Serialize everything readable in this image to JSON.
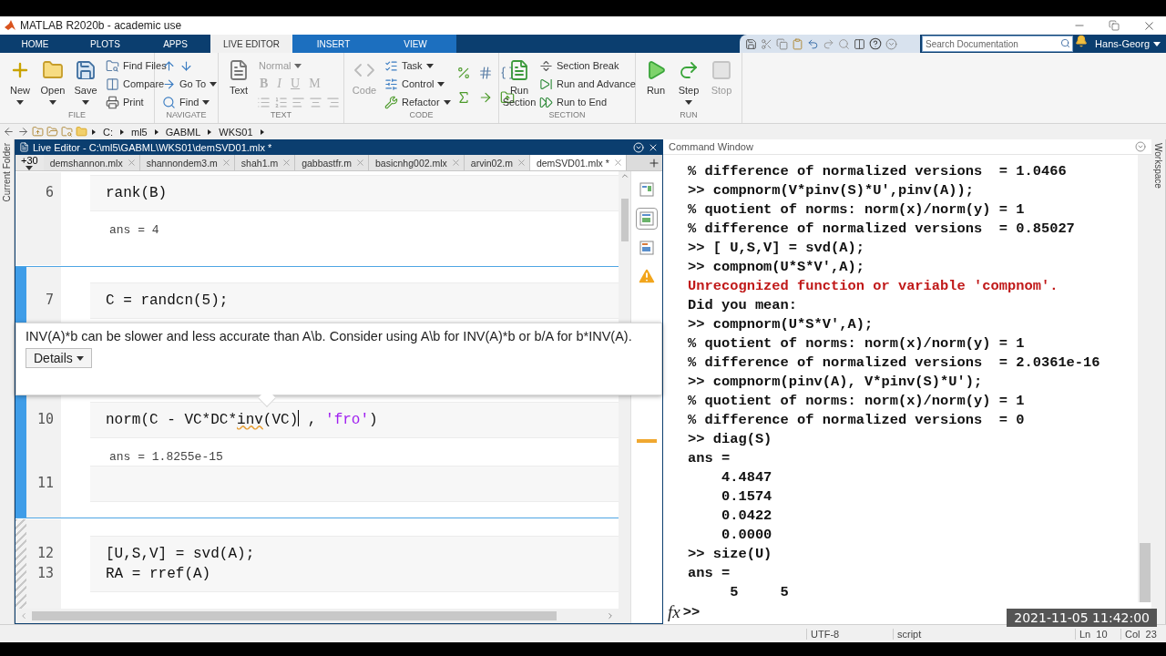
{
  "title_bar": {
    "title": "MATLAB R2020b - academic use"
  },
  "ribbon_tabs": [
    {
      "label": "HOME",
      "kind": "main",
      "selected": false
    },
    {
      "label": "PLOTS",
      "kind": "main",
      "selected": false
    },
    {
      "label": "APPS",
      "kind": "main",
      "selected": false
    },
    {
      "label": "LIVE EDITOR",
      "kind": "contextual",
      "selected": true
    },
    {
      "label": "INSERT",
      "kind": "contextual",
      "selected": false
    },
    {
      "label": "VIEW",
      "kind": "contextual",
      "selected": false
    }
  ],
  "search": {
    "placeholder": "Search Documentation"
  },
  "user": {
    "name": "Hans-Georg"
  },
  "toolstrip": [
    {
      "title": "FILE",
      "groups": [
        {
          "kind": "large",
          "label": "New",
          "caret": true,
          "disabled": false
        },
        {
          "kind": "large",
          "label": "Open",
          "caret": true,
          "disabled": false
        },
        {
          "kind": "large",
          "label": "Save",
          "caret": true,
          "disabled": false
        },
        {
          "kind": "column",
          "items": [
            {
              "kind": "button",
              "label": "Find Files",
              "caret": false,
              "disabled": false
            },
            {
              "kind": "button",
              "label": "Compare",
              "caret": false,
              "disabled": false
            },
            {
              "kind": "button",
              "label": "Print",
              "caret": false,
              "disabled": false
            }
          ]
        }
      ]
    },
    {
      "title": "NAVIGATE",
      "groups": [
        {
          "kind": "column",
          "items": [
            {
              "kind": "arrows"
            },
            {
              "kind": "button",
              "label": "Go To",
              "caret": true,
              "disabled": false
            },
            {
              "kind": "button",
              "label": "Find",
              "caret": true,
              "disabled": false
            }
          ]
        }
      ]
    },
    {
      "title": "TEXT",
      "groups": [
        {
          "kind": "large",
          "label": "Text",
          "caret": false,
          "disabled": false
        },
        {
          "kind": "format",
          "style": {
            "label": "Normal",
            "caret": true,
            "disabled": true
          },
          "marks": [
            {
              "label": "B",
              "disabled": true
            },
            {
              "label": "I",
              "disabled": true
            },
            {
              "label": "U",
              "disabled": true
            },
            {
              "label": "M",
              "disabled": true
            }
          ]
        }
      ]
    },
    {
      "title": "CODE",
      "groups": [
        {
          "kind": "large",
          "label": "Code",
          "caret": false,
          "disabled": true
        },
        {
          "kind": "column",
          "items": [
            {
              "kind": "button",
              "label": "Task",
              "caret": true,
              "disabled": false
            },
            {
              "kind": "button",
              "label": "Control",
              "caret": true,
              "disabled": false
            },
            {
              "kind": "button",
              "label": "Refactor",
              "caret": true,
              "disabled": false
            }
          ]
        },
        {
          "kind": "icon-grid"
        }
      ]
    },
    {
      "title": "SECTION",
      "groups": [
        {
          "kind": "large",
          "label": "Run Section",
          "caret": false,
          "disabled": false
        },
        {
          "kind": "column",
          "items": [
            {
              "kind": "button",
              "label": "Section Break",
              "caret": false,
              "disabled": false
            },
            {
              "kind": "button",
              "label": "Run and Advance",
              "caret": false,
              "disabled": false
            },
            {
              "kind": "button",
              "label": "Run to End",
              "caret": false,
              "disabled": false
            }
          ]
        }
      ]
    },
    {
      "title": "RUN",
      "groups": [
        {
          "kind": "large",
          "label": "Run",
          "caret": false,
          "disabled": false
        },
        {
          "kind": "large",
          "label": "Step",
          "caret": true,
          "disabled": false
        },
        {
          "kind": "large",
          "label": "Stop",
          "caret": false,
          "disabled": true
        }
      ]
    }
  ],
  "address_bar": {
    "segments": [
      "C:",
      "ml5",
      "GABML",
      "WKS01"
    ]
  },
  "side_panels": {
    "left": "Current Folder",
    "right": "Workspace"
  },
  "editor": {
    "title": "Live Editor - C:\\ml5\\GABML\\WKS01\\demSVD01.mlx *",
    "overflow_tab": "+30",
    "tabs": [
      {
        "label": "demshannon.mlx",
        "selected": false
      },
      {
        "label": "shannondem3.m",
        "selected": false
      },
      {
        "label": "shah1.m",
        "selected": false
      },
      {
        "label": "gabbastfr.m",
        "selected": false
      },
      {
        "label": "basicnhg002.mlx",
        "selected": false
      },
      {
        "label": "arvin02.m",
        "selected": false
      },
      {
        "label": "demSVD01.mlx *",
        "selected": true
      }
    ],
    "sections": [
      {
        "kind": "normal",
        "blocks": [
          {
            "kind": "code",
            "lines": [
              {
                "number": "6",
                "tokens": [
                  {
                    "kind": "plain",
                    "text": "rank(B)"
                  }
                ]
              }
            ]
          },
          {
            "kind": "output",
            "text": "ans = 4"
          }
        ]
      },
      {
        "kind": "active",
        "blocks": [
          {
            "kind": "code",
            "lines": [
              {
                "number": "7",
                "tokens": [
                  {
                    "kind": "plain",
                    "text": "C = randcn(5);"
                  }
                ]
              }
            ]
          },
          {
            "kind": "tooltip",
            "text": "INV(A)*b can be slower and less accurate than A\\b. Consider using A\\b for INV(A)*b or b/A for b*INV(A).",
            "button": "Details"
          },
          {
            "kind": "code",
            "lines": [
              {
                "number": "10",
                "tokens": [
                  {
                    "kind": "plain",
                    "text": "norm(C - VC*DC*"
                  },
                  {
                    "kind": "warning",
                    "text": "inv"
                  },
                  {
                    "kind": "plain",
                    "text": "(VC)"
                  },
                  {
                    "kind": "cursor"
                  },
                  {
                    "kind": "plain",
                    "text": " , "
                  },
                  {
                    "kind": "string",
                    "text": "'fro'"
                  },
                  {
                    "kind": "plain",
                    "text": ")"
                  }
                ]
              }
            ]
          },
          {
            "kind": "output",
            "text": "ans = 1.8255e-15"
          },
          {
            "kind": "code",
            "lines": [
              {
                "number": "11"
              }
            ]
          }
        ]
      },
      {
        "kind": "stale",
        "blocks": [
          {
            "kind": "code",
            "lines": [
              {
                "number": "12",
                "tokens": [
                  {
                    "kind": "plain",
                    "text": "[U,S,V] = svd(A);"
                  }
                ]
              },
              {
                "number": "13",
                "tokens": [
                  {
                    "kind": "plain",
                    "text": "RA = rref(A)"
                  }
                ]
              }
            ]
          }
        ]
      }
    ]
  },
  "command_window": {
    "title": "Command Window",
    "prompt_icon": "fx",
    "prompt": ">>",
    "lines": [
      {
        "kind": "text",
        "text": "% difference of normalized versions  = 1.0466"
      },
      {
        "kind": "text",
        "text": ">> compnorm(V*pinv(S)*U',pinv(A));"
      },
      {
        "kind": "text",
        "text": "% quotient of norms: norm(x)/norm(y) = 1"
      },
      {
        "kind": "text",
        "text": "% difference of normalized versions  = 0.85027"
      },
      {
        "kind": "text",
        "text": ">> [ U,S,V] = svd(A);"
      },
      {
        "kind": "text",
        "text": ">> compnom(U*S*V',A);"
      },
      {
        "kind": "error",
        "text": "Unrecognized function or variable 'compnom'."
      },
      {
        "kind": "text",
        "text": "Did you mean:"
      },
      {
        "kind": "text",
        "text": ">> compnorm(U*S*V',A);"
      },
      {
        "kind": "text",
        "text": "% quotient of norms: norm(x)/norm(y) = 1"
      },
      {
        "kind": "text",
        "text": "% difference of normalized versions  = 2.0361e-16"
      },
      {
        "kind": "text",
        "text": ">> compnorm(pinv(A), V*pinv(S)*U');"
      },
      {
        "kind": "text",
        "text": "% quotient of norms: norm(x)/norm(y) = 1"
      },
      {
        "kind": "text",
        "text": "% difference of normalized versions  = 0"
      },
      {
        "kind": "text",
        "text": ">> diag(S)"
      },
      {
        "kind": "text",
        "text": "ans ="
      },
      {
        "kind": "text",
        "text": "    4.4847"
      },
      {
        "kind": "text",
        "text": "    0.1574"
      },
      {
        "kind": "text",
        "text": "    0.0422"
      },
      {
        "kind": "text",
        "text": "    0.0000"
      },
      {
        "kind": "text",
        "text": ">> size(U)"
      },
      {
        "kind": "text",
        "text": "ans ="
      },
      {
        "kind": "text",
        "text": "     5     5"
      }
    ]
  },
  "status_bar": {
    "encoding": "UTF-8",
    "file_type": "script",
    "line": "Ln  10",
    "column": "Col  23"
  },
  "timestamp": "2021-11-05 11:42:00"
}
